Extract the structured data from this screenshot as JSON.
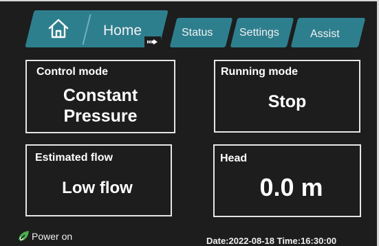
{
  "tabs": {
    "home": "Home",
    "status": "Status",
    "settings": "Settings",
    "assist": "Assist"
  },
  "panels": {
    "control_mode": {
      "title": "Control mode",
      "value_line1": "Constant",
      "value_line2": "Pressure"
    },
    "running_mode": {
      "title": "Running mode",
      "value": "Stop"
    },
    "estimated_flow": {
      "title": "Estimated flow",
      "value": "Low flow"
    },
    "head": {
      "title": "Head",
      "value": "0.0 m"
    }
  },
  "footer": {
    "power_status": "Power on",
    "datetime": "Date:2022-08-18 Time:16:30:00"
  },
  "icons": {
    "home": "home-icon",
    "cursor": "cursor-icon",
    "power": "leaf-icon"
  },
  "colors": {
    "tab": "#2e7f8e",
    "background": "#1d1d1d",
    "power_icon": "#4caf50"
  }
}
